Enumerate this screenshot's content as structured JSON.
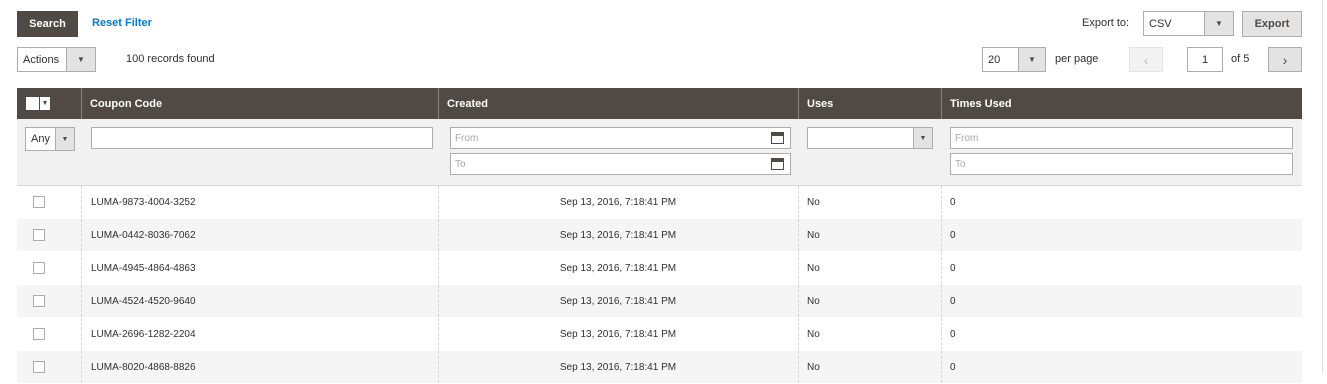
{
  "toolbar": {
    "search_label": "Search",
    "reset_label": "Reset Filter",
    "export_label": "Export to:",
    "export_format": "CSV",
    "export_button": "Export",
    "actions_label": "Actions",
    "records_found": "100 records found",
    "per_page_value": "20",
    "per_page_label": "per page",
    "page_current": "1",
    "page_total": "of 5"
  },
  "grid": {
    "columns": [
      "Coupon Code",
      "Created",
      "Uses",
      "Times Used"
    ],
    "filters": {
      "massaction": "Any",
      "created_from": "From",
      "created_to": "To",
      "times_used_from": "From",
      "times_used_to": "To"
    },
    "rows": [
      {
        "code": "LUMA-9873-4004-3252",
        "created": "Sep 13, 2016, 7:18:41 PM",
        "uses": "No",
        "times_used": "0"
      },
      {
        "code": "LUMA-0442-8036-7062",
        "created": "Sep 13, 2016, 7:18:41 PM",
        "uses": "No",
        "times_used": "0"
      },
      {
        "code": "LUMA-4945-4864-4863",
        "created": "Sep 13, 2016, 7:18:41 PM",
        "uses": "No",
        "times_used": "0"
      },
      {
        "code": "LUMA-4524-4520-9640",
        "created": "Sep 13, 2016, 7:18:41 PM",
        "uses": "No",
        "times_used": "0"
      },
      {
        "code": "LUMA-2696-1282-2204",
        "created": "Sep 13, 2016, 7:18:41 PM",
        "uses": "No",
        "times_used": "0"
      },
      {
        "code": "LUMA-8020-4868-8826",
        "created": "Sep 13, 2016, 7:18:41 PM",
        "uses": "No",
        "times_used": "0"
      }
    ]
  },
  "icons": {
    "dropdown": "chevron-down-icon",
    "calendar": "calendar-icon",
    "prev": "chevron-left-icon",
    "next": "chevron-right-icon"
  },
  "colors": {
    "header_bg": "#514943",
    "link": "#007bdb",
    "row_alt": "#f5f5f5"
  }
}
